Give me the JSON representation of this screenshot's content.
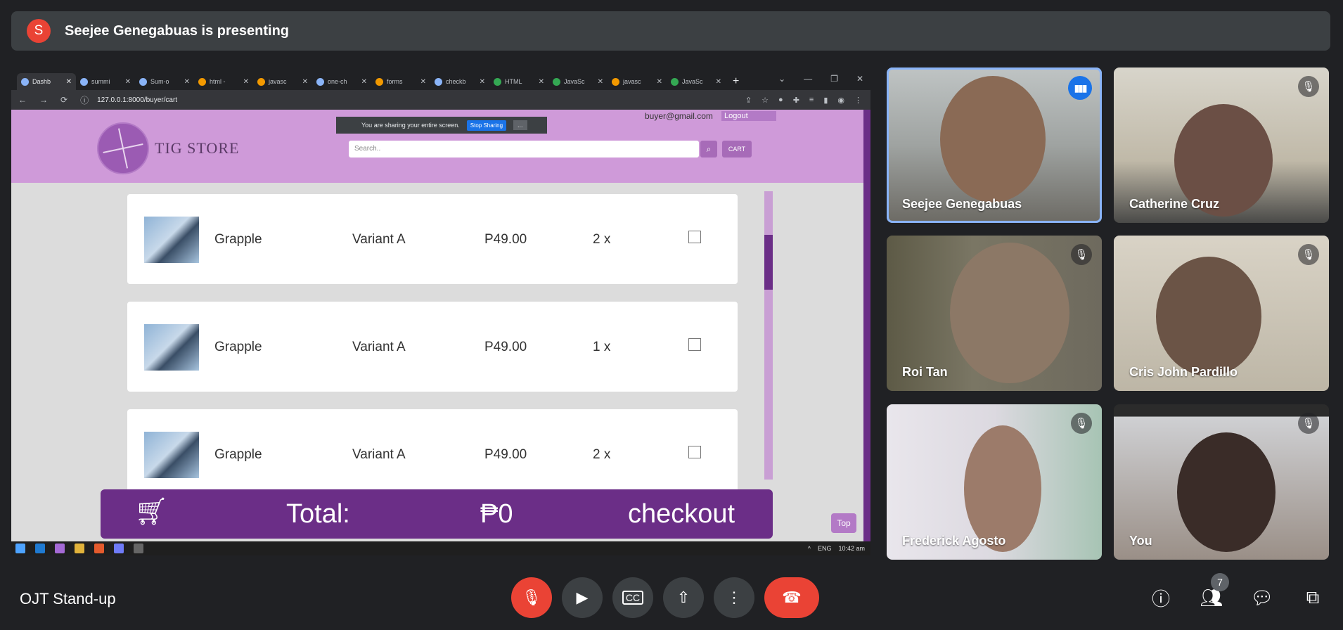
{
  "banner": {
    "avatar_letter": "S",
    "text": "Seejee Genegabuas is presenting"
  },
  "shared_screen": {
    "tabs": [
      {
        "label": "Dashb",
        "active": true
      },
      {
        "label": "summi"
      },
      {
        "label": "Sum-o"
      },
      {
        "label": "html -"
      },
      {
        "label": "javasc"
      },
      {
        "label": "one-ch"
      },
      {
        "label": "forms"
      },
      {
        "label": "checkb"
      },
      {
        "label": "HTML"
      },
      {
        "label": "JavaSc"
      },
      {
        "label": "javasc"
      },
      {
        "label": "JavaSc"
      }
    ],
    "new_tab": "+",
    "url": "127.0.0.1:8000/buyer/cart",
    "share_notice": {
      "text": "You are sharing your entire screen.",
      "stop_label": "Stop Sharing",
      "hide_label": "..."
    },
    "store": {
      "name": "TIG STORE",
      "account_email": "buyer@gmail.com",
      "logout_label": "Logout",
      "search_placeholder": "Search..",
      "cart_label": "CART"
    },
    "cart_items": [
      {
        "name": "Grapple",
        "variant": "Variant A",
        "price": "P49.00",
        "qty": "2 x"
      },
      {
        "name": "Grapple",
        "variant": "Variant A",
        "price": "P49.00",
        "qty": "1 x"
      },
      {
        "name": "Grapple",
        "variant": "Variant A",
        "price": "P49.00",
        "qty": "2 x"
      }
    ],
    "checkout": {
      "total_label": "Total:",
      "total_value": "₱0",
      "checkout_label": "checkout"
    },
    "top_label": "Top",
    "taskbar": {
      "lang": "ENG",
      "time": "10:42 am"
    }
  },
  "participants": [
    {
      "name": "Seejee Genegabuas",
      "speaking": true
    },
    {
      "name": "Catherine Cruz",
      "muted": true
    },
    {
      "name": "Roi Tan",
      "muted": true
    },
    {
      "name": "Cris John Pardillo",
      "muted": true
    },
    {
      "name": "Frederick Agosto",
      "muted": true
    },
    {
      "name": "You",
      "muted": true
    }
  ],
  "meeting": {
    "title": "OJT Stand-up",
    "people_count": "7"
  }
}
